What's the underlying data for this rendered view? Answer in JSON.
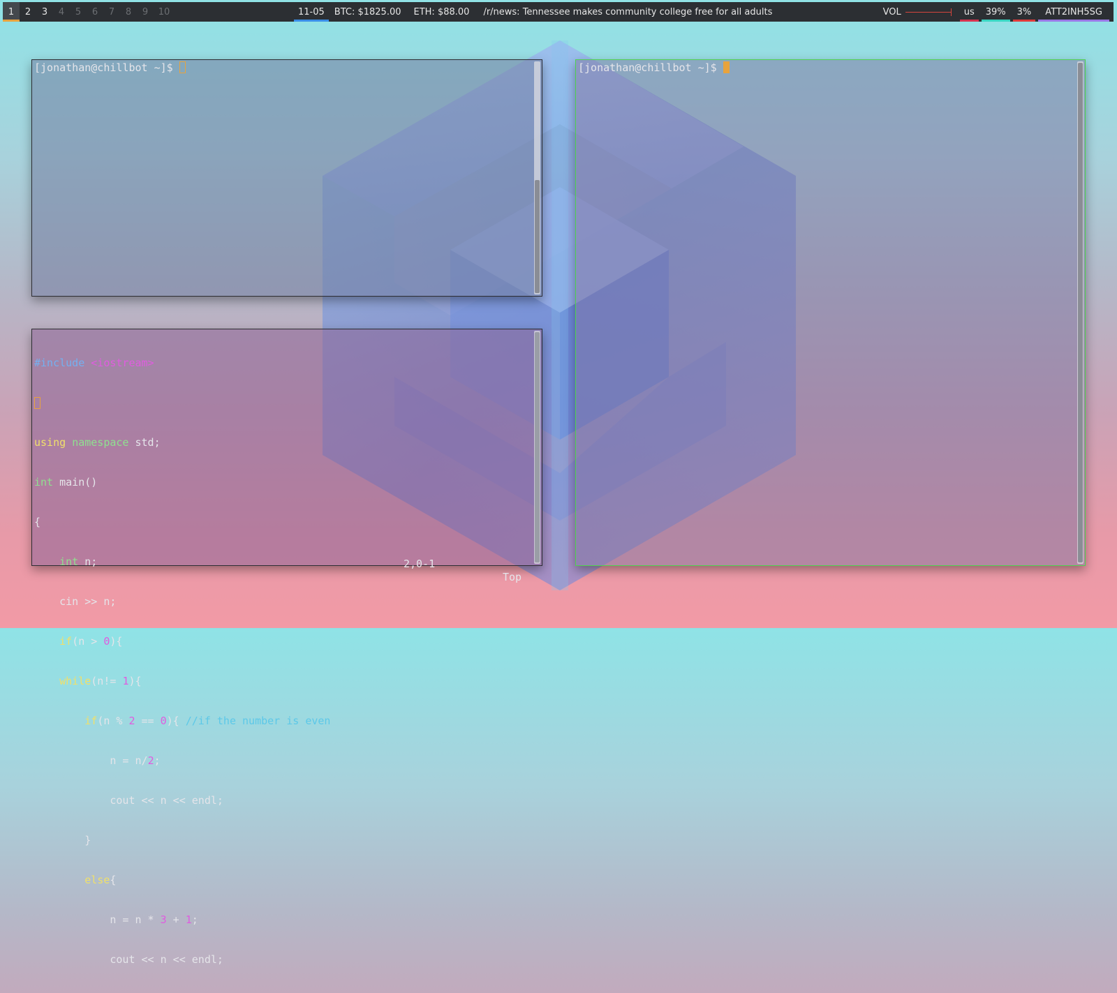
{
  "topbar": {
    "workspaces": [
      {
        "label": "1",
        "state": "active"
      },
      {
        "label": "2",
        "state": "occupied"
      },
      {
        "label": "3",
        "state": "occupied"
      },
      {
        "label": "4",
        "state": "empty"
      },
      {
        "label": "5",
        "state": "empty"
      },
      {
        "label": "6",
        "state": "empty"
      },
      {
        "label": "7",
        "state": "empty"
      },
      {
        "label": "8",
        "state": "empty"
      },
      {
        "label": "9",
        "state": "empty"
      },
      {
        "label": "10",
        "state": "empty"
      }
    ],
    "date": "11-05",
    "btc": "BTC: $1825.00",
    "eth": "ETH: $88.00",
    "news": "/r/news: Tennessee makes community college free for all adults",
    "volume_label": "VOL",
    "keyboard_layout": "us",
    "cpu": "39%",
    "battery": "3%",
    "wifi": "ATT2INH5SG",
    "colors": {
      "accent": "#e8a33d",
      "date_ul": "#3a8ee8",
      "kb_ul": "#d6334f",
      "cpu_ul": "#39d6c2",
      "bat_ul": "#e03a3a",
      "wifi_ul": "#9a78e6"
    }
  },
  "terminal_top_left": {
    "prompt": "[jonathan@chillbot ~]$ "
  },
  "terminal_right": {
    "prompt": "[jonathan@chillbot ~]$ "
  },
  "editor": {
    "status_position": "2,0-1",
    "status_scroll": "Top"
  }
}
